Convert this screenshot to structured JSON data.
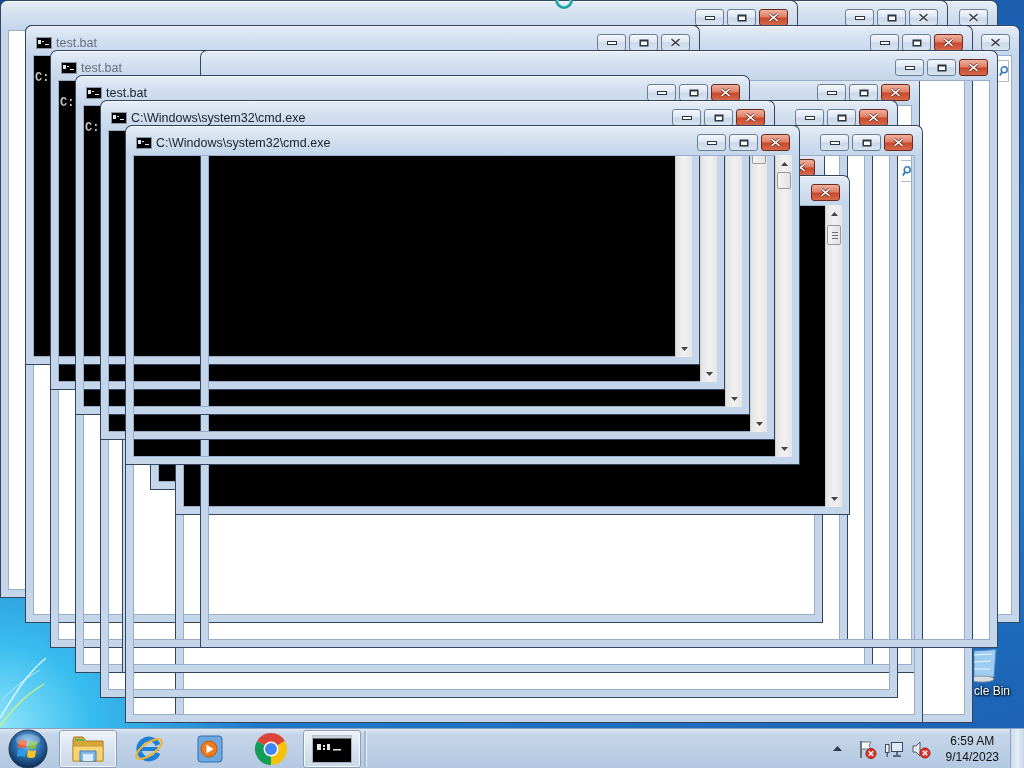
{
  "windows": [
    {
      "kind": "explorer",
      "active": false,
      "buttons": [
        {
          "kind": "close"
        }
      ],
      "search_box": true
    },
    {
      "kind": "explorer",
      "active": false,
      "buttons": [
        {
          "kind": "close"
        }
      ]
    },
    {
      "kind": "explorer",
      "active": false,
      "buttons": [
        {
          "kind": "minimize"
        },
        {
          "kind": "maximize"
        },
        {
          "kind": "close"
        }
      ]
    },
    {
      "kind": "explorer",
      "active": true,
      "buttons": [
        {
          "kind": "minimize"
        },
        {
          "kind": "maximize"
        },
        {
          "kind": "close"
        }
      ]
    },
    {
      "kind": "explorer"
    },
    {
      "kind": "explorer",
      "active": true,
      "buttons": [
        {
          "kind": "minimize"
        },
        {
          "kind": "maximize"
        },
        {
          "kind": "close"
        }
      ]
    },
    {
      "kind": "console",
      "title": "test.bat",
      "active": false,
      "buttons": [
        {
          "kind": "minimize"
        },
        {
          "kind": "maximize"
        },
        {
          "kind": "close"
        }
      ],
      "console_text": "C:"
    },
    {
      "kind": "explorer"
    },
    {
      "kind": "console",
      "title": "test.bat",
      "active": false,
      "console_text": "C:"
    },
    {
      "kind": "explorer",
      "active": true,
      "buttons": [
        {
          "kind": "minimize"
        },
        {
          "kind": "maximize"
        },
        {
          "kind": "close"
        }
      ]
    },
    {
      "kind": "explorer"
    },
    {
      "kind": "explorer",
      "active": true,
      "buttons": [
        {
          "kind": "minimize"
        },
        {
          "kind": "maximize"
        },
        {
          "kind": "close"
        }
      ]
    },
    {
      "kind": "console",
      "title": "test.bat",
      "active": true,
      "buttons": [
        {
          "kind": "minimize"
        },
        {
          "kind": "maximize"
        },
        {
          "kind": "close"
        }
      ],
      "console_text": "C:"
    },
    {
      "kind": "explorer",
      "active": true,
      "buttons": [
        {
          "kind": "minimize"
        },
        {
          "kind": "maximize"
        },
        {
          "kind": "close"
        }
      ]
    },
    {
      "kind": "console",
      "title": "C:\\Windows\\system32\\cmd.exe",
      "active": true,
      "buttons": [
        {
          "kind": "minimize"
        },
        {
          "kind": "maximize"
        },
        {
          "kind": "close"
        }
      ]
    },
    {
      "kind": "explorer",
      "active": true,
      "buttons": [
        {
          "kind": "minimize"
        },
        {
          "kind": "maximize"
        },
        {
          "kind": "close"
        }
      ],
      "search_box": true
    },
    {
      "kind": "console",
      "title": "C:\\Windows\\system32\\cmd.exe",
      "active": true,
      "buttons": [
        {
          "kind": "minimize"
        },
        {
          "kind": "maximize"
        },
        {
          "kind": "close"
        }
      ]
    },
    {
      "kind": "console",
      "active": true,
      "buttons": [
        {
          "kind": "close"
        }
      ]
    },
    {
      "kind": "console",
      "active": true,
      "buttons": [
        {
          "kind": "close"
        }
      ]
    }
  ],
  "desktop_icons": [
    {
      "label": "cle Bin"
    }
  ],
  "taskbar": {
    "items": [
      {
        "kind": "folder",
        "open": true
      },
      {
        "kind": "e-logo",
        "open": false
      },
      {
        "kind": "media",
        "open": false
      },
      {
        "kind": "round-logo",
        "open": false
      },
      {
        "kind": "terminal",
        "open": true
      }
    ],
    "tray": {
      "action_center_alert": true,
      "volume_muted": true
    },
    "clock": {
      "time": "6:59 AM",
      "date": "9/14/2023"
    }
  }
}
